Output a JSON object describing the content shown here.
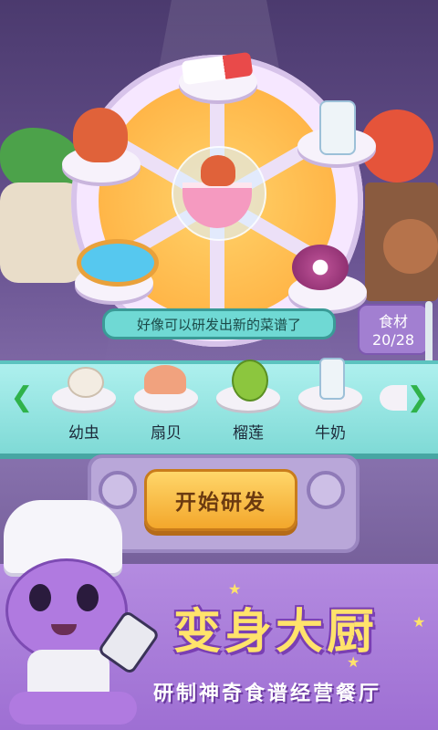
{
  "hint_message": "好像可以研发出新的菜谱了",
  "counter": {
    "label": "食材",
    "value": "20/28"
  },
  "ingredients": [
    {
      "label": "幼虫",
      "icon": "larva-icon"
    },
    {
      "label": "扇贝",
      "icon": "scallop-icon"
    },
    {
      "label": "榴莲",
      "icon": "durian-icon"
    },
    {
      "label": "牛奶",
      "icon": "milk-icon"
    }
  ],
  "start_button": {
    "label": "开始研发"
  },
  "banner": {
    "title": "变身大厨",
    "subtitle": "研制神奇食谱经营餐厅"
  },
  "wheel_items": [
    "toothpaste-icon",
    "milk-bottle-icon",
    "onion-icon",
    "water-bowl-icon",
    "octopus-icon",
    "octopus-soup-icon"
  ],
  "colors": {
    "accent": "#ffd36b",
    "shelf": "#7fdad6",
    "banner": "#9e6fd3",
    "arrow": "#2fb24a"
  }
}
